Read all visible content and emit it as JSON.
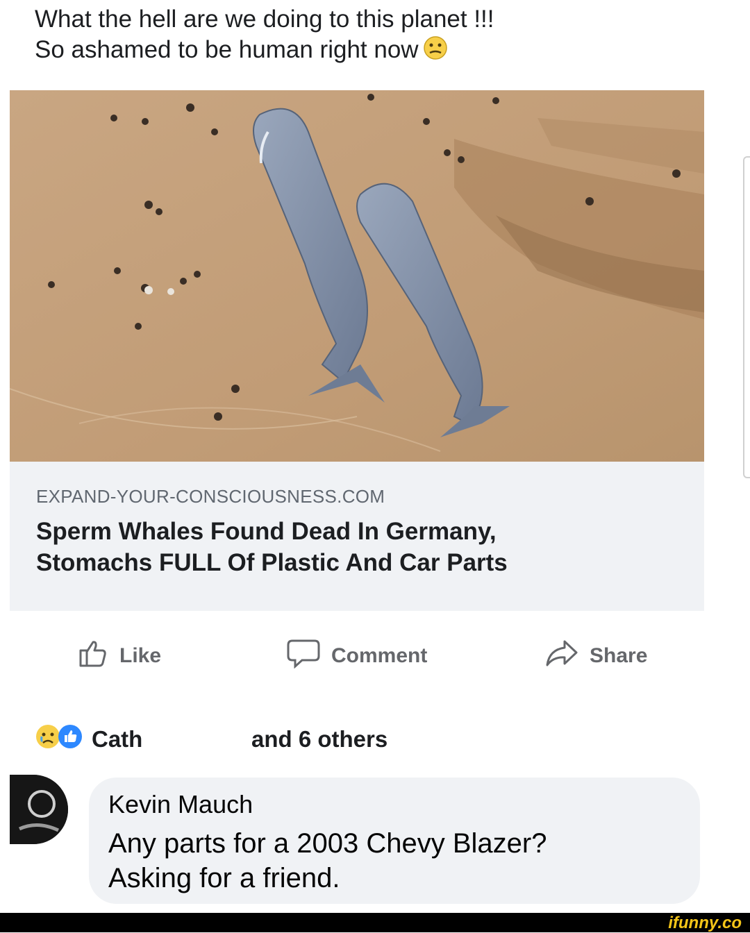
{
  "post": {
    "text_line1": "What the hell are we doing to this planet !!!",
    "text_line2": "So ashamed to be human right now",
    "emoji_icon": "confused-face-icon"
  },
  "link": {
    "domain": "EXPAND-YOUR-CONSCIOUSNESS.COM",
    "headline_line1": "Sperm Whales Found Dead In Germany,",
    "headline_line2": "Stomachs FULL Of Plastic And Car Parts"
  },
  "actions": {
    "like_label": "Like",
    "comment_label": "Comment",
    "share_label": "Share"
  },
  "reactions": {
    "icons": [
      "sad-face-icon",
      "like-icon"
    ],
    "name": "Cath",
    "others": "and 6 others"
  },
  "comment": {
    "author": "Kevin Mauch",
    "text_line1": "Any parts for a 2003 Chevy Blazer?",
    "text_line2": "Asking for a friend."
  },
  "watermark": "ifunny.co",
  "colors": {
    "sand": "#c6a47f",
    "whale": "#7f8fa7",
    "action_gray": "#65676b",
    "card_bg": "#f0f2f5"
  }
}
